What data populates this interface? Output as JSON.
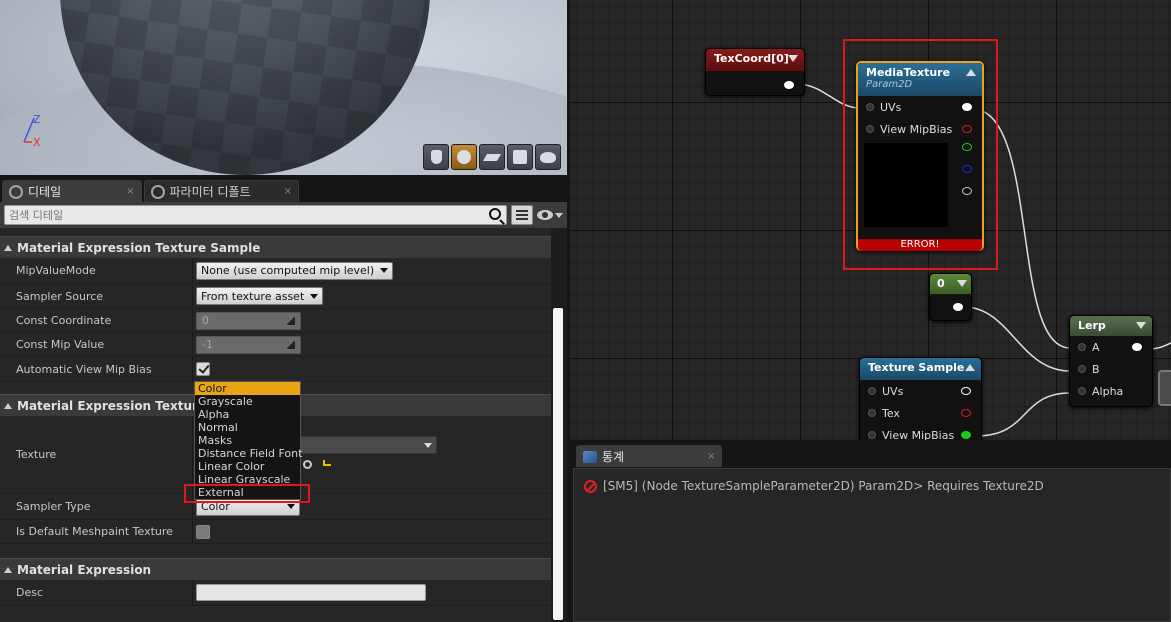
{
  "details": {
    "tabs": [
      {
        "label": "디테일",
        "close": "×"
      },
      {
        "label": "파라미터 디폴트",
        "close": "×"
      }
    ],
    "search_placeholder": "검색 디테일",
    "sections": [
      {
        "title": "Material Expression Texture Sample"
      },
      {
        "title": "Material Expression Texture Ba"
      },
      {
        "title": "Material Expression"
      }
    ],
    "rows": {
      "mip_value_mode": {
        "label": "MipValueMode",
        "value": "None (use computed mip level)"
      },
      "sampler_source": {
        "label": "Sampler Source",
        "value": "From texture asset"
      },
      "const_coordinate": {
        "label": "Const Coordinate",
        "value": "0"
      },
      "const_mip_value": {
        "label": "Const Mip Value",
        "value": "-1"
      },
      "auto_view_mip_bias": {
        "label": "Automatic View Mip Bias",
        "checked": true
      },
      "texture": {
        "label": "Texture"
      },
      "sampler_type": {
        "label": "Sampler Type",
        "value": "Color"
      },
      "is_default_meshpaint": {
        "label": "Is Default Meshpaint Texture",
        "checked": false
      },
      "desc": {
        "label": "Desc",
        "value": ""
      }
    },
    "sampler_type_options": [
      "Color",
      "Grayscale",
      "Alpha",
      "Normal",
      "Masks",
      "Distance Field Font",
      "Linear Color",
      "Linear Grayscale",
      "External"
    ],
    "selected_option": "Color",
    "highlighted_option": "External"
  },
  "graph": {
    "texcoord": {
      "title": "TexCoord[0]"
    },
    "media_texture": {
      "title": "MediaTexture",
      "subtitle": "Param2D",
      "pins": [
        "UVs",
        "View MipBias"
      ],
      "error": "ERROR!"
    },
    "constant": {
      "title": "0"
    },
    "texture_sample": {
      "title": "Texture Sample",
      "pins": [
        "UVs",
        "Tex",
        "View MipBias"
      ]
    },
    "lerp": {
      "title": "Lerp",
      "pins": [
        "A",
        "B",
        "Alpha"
      ]
    },
    "pin_colors": {
      "white": "#ffffff",
      "red": "#e01a1a",
      "green": "#1ec81e",
      "blue": "#1a2ee0",
      "gray": "#bbbbbb"
    }
  },
  "stats": {
    "tab_label": "통계",
    "tab_close": "×",
    "message": "[SM5] (Node TextureSampleParameter2D) Param2D> Requires Texture2D"
  },
  "viewport": {
    "axis_z": "Z",
    "axis_x": "X",
    "preview_buttons": [
      "cylinder-icon",
      "sphere-icon",
      "plane-icon",
      "cube-icon",
      "teapot-icon"
    ]
  }
}
